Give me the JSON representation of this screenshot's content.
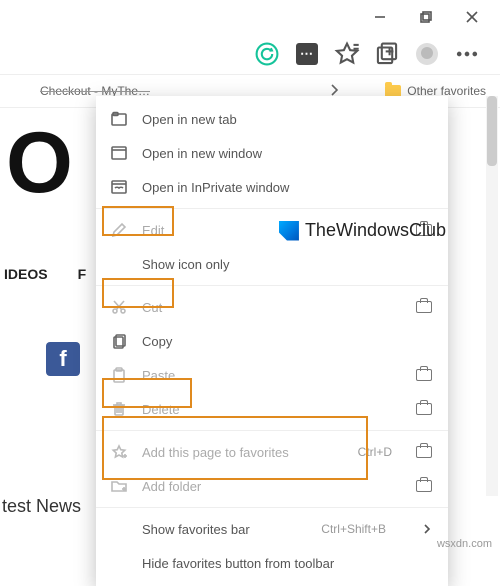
{
  "window": {
    "tab_truncated": "Checkout - MyThe…"
  },
  "favbar": {
    "other_favorites": "Other favorites"
  },
  "left": {
    "letter": "O",
    "tabs": [
      "IDEOS",
      "F"
    ],
    "fb": "f",
    "news": "test News"
  },
  "menu": {
    "open_tab": "Open in new tab",
    "open_window": "Open in new window",
    "open_private": "Open in InPrivate window",
    "edit": "Edit",
    "show_icon_only": "Show icon only",
    "cut": "Cut",
    "copy": "Copy",
    "paste": "Paste",
    "delete": "Delete",
    "add_page": "Add this page to favorites",
    "add_page_hint": "Ctrl+D",
    "add_folder": "Add folder",
    "show_favbar": "Show favorites bar",
    "show_favbar_hint": "Ctrl+Shift+B",
    "hide_button": "Hide favorites button from toolbar"
  },
  "watermark": {
    "club": "TheWindowsClub",
    "url": "wsxdn.com"
  }
}
